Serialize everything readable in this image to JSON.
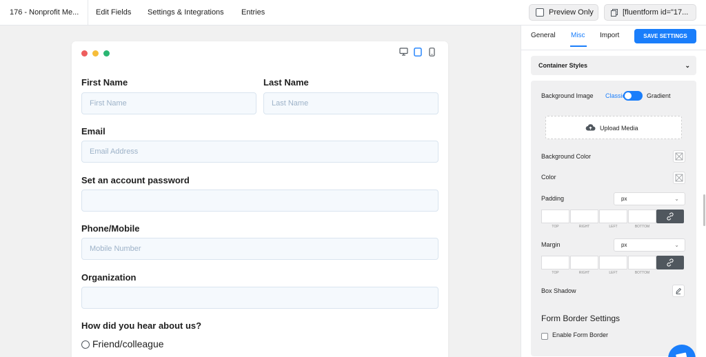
{
  "topbar": {
    "form_title": "176 - Nonprofit Me...",
    "nav": [
      "Edit Fields",
      "Settings & Integrations",
      "Entries"
    ],
    "preview_label": "Preview Only",
    "shortcode_label": "[fluentform id=\"17..."
  },
  "canvas": {
    "window_dots": [
      "#ee5e5e",
      "#f6bd3a",
      "#2bb673"
    ],
    "device_icons": [
      "desktop-icon",
      "tablet-icon",
      "mobile-icon"
    ],
    "fields": {
      "first_name": {
        "label": "First Name",
        "placeholder": "First Name"
      },
      "last_name": {
        "label": "Last Name",
        "placeholder": "Last Name"
      },
      "email": {
        "label": "Email",
        "placeholder": "Email Address"
      },
      "password": {
        "label": "Set an account password",
        "placeholder": ""
      },
      "phone": {
        "label": "Phone/Mobile",
        "placeholder": "Mobile Number"
      },
      "organization": {
        "label": "Organization",
        "placeholder": ""
      },
      "hear_about": {
        "label": "How did you hear about us?",
        "options": [
          "Friend/colleague"
        ]
      }
    }
  },
  "panel": {
    "tabs": [
      "General",
      "Misc",
      "Import"
    ],
    "active_tab": "Misc",
    "save_label": "SAVE SETTINGS",
    "section_title": "Container Styles",
    "background_image": {
      "label": "Background Image",
      "option_left": "Classic",
      "option_right": "Gradient",
      "toggle_on": true
    },
    "upload_label": "Upload Media",
    "background_color_label": "Background Color",
    "color_label": "Color",
    "padding": {
      "label": "Padding",
      "unit": "px",
      "sides": [
        "TOP",
        "RIGHT",
        "LEFT",
        "BOTTOM"
      ]
    },
    "margin": {
      "label": "Margin",
      "unit": "px",
      "sides": [
        "TOP",
        "RIGHT",
        "LEFT",
        "BOTTOM"
      ]
    },
    "box_shadow_label": "Box Shadow",
    "border_settings_title": "Form Border Settings",
    "enable_border_label": "Enable Form Border"
  },
  "colors": {
    "accent": "#1a7efb",
    "link_button": "#50575e",
    "input_bg": "#f5f9fd"
  }
}
